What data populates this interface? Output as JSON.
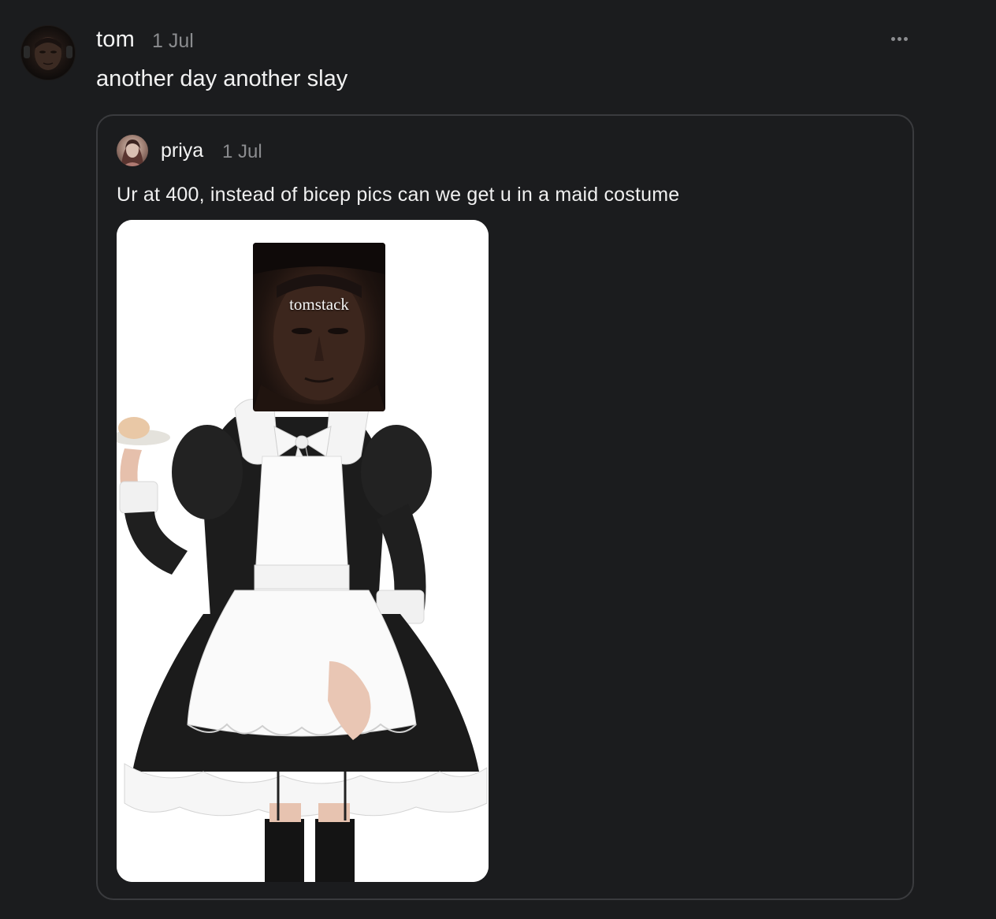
{
  "post": {
    "author": "tom",
    "date": "1 Jul",
    "text": "another day another slay",
    "avatar_icon": "user-avatar",
    "more_icon": "more-horizontal-icon"
  },
  "quote": {
    "author": "priya",
    "date": "1 Jul",
    "text": "Ur at 400, instead of bicep pics can we get u in a maid costume",
    "avatar_icon": "user-avatar",
    "image": {
      "caption": "tomstack"
    }
  },
  "colors": {
    "background": "#1b1c1e",
    "card_border": "#3a3b3e",
    "primary_text": "#f2f2f2",
    "secondary_text": "#8b8c8f"
  }
}
